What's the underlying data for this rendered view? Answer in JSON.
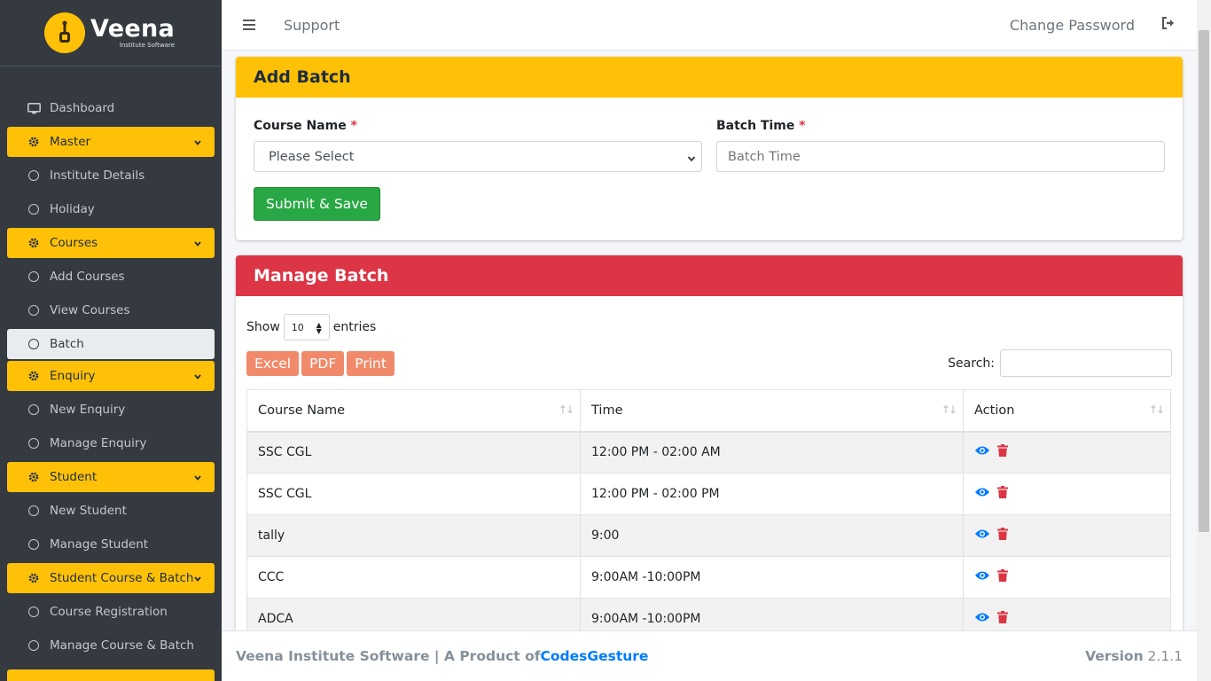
{
  "brand": {
    "name": "Veena",
    "subtitle": "Institute Software"
  },
  "sidebar": {
    "items": [
      {
        "label": "Dashboard",
        "type": "link",
        "icon": "monitor-icon"
      },
      {
        "label": "Master",
        "type": "header",
        "icon": "gear-icon"
      },
      {
        "label": "Institute Details",
        "type": "sub"
      },
      {
        "label": "Holiday",
        "type": "sub"
      },
      {
        "label": "Courses",
        "type": "header",
        "icon": "gear-icon"
      },
      {
        "label": "Add Courses",
        "type": "sub"
      },
      {
        "label": "View Courses",
        "type": "sub"
      },
      {
        "label": "Batch",
        "type": "active"
      },
      {
        "label": "Enquiry",
        "type": "header",
        "icon": "gear-icon"
      },
      {
        "label": "New Enquiry",
        "type": "sub"
      },
      {
        "label": "Manage Enquiry",
        "type": "sub"
      },
      {
        "label": "Student",
        "type": "header",
        "icon": "gear-icon"
      },
      {
        "label": "New Student",
        "type": "sub"
      },
      {
        "label": "Manage Student",
        "type": "sub"
      },
      {
        "label": "Student Course & Batch",
        "type": "header",
        "icon": "gear-icon"
      },
      {
        "label": "Course Registration",
        "type": "sub"
      },
      {
        "label": "Manage Course & Batch",
        "type": "sub"
      }
    ]
  },
  "topbar": {
    "support": "Support",
    "change_password": "Change Password"
  },
  "add_batch": {
    "title": "Add Batch",
    "course_label": "Course Name",
    "course_selected": "Please Select",
    "time_label": "Batch Time",
    "time_placeholder": "Batch Time",
    "required_mark": "*",
    "submit_label": "Submit & Save"
  },
  "manage_batch": {
    "title": "Manage Batch",
    "show_label": "Show",
    "entries_value": "10",
    "entries_label": "entries",
    "buttons": [
      "Excel",
      "PDF",
      "Print"
    ],
    "search_label": "Search:",
    "columns": [
      "Course Name",
      "Time",
      "Action"
    ],
    "rows": [
      {
        "course": "SSC CGL",
        "time": "12:00 PM - 02:00 AM"
      },
      {
        "course": "SSC CGL",
        "time": "12:00 PM - 02:00 PM"
      },
      {
        "course": "tally",
        "time": "9:00"
      },
      {
        "course": "CCC",
        "time": "9:00AM -10:00PM"
      },
      {
        "course": "ADCA",
        "time": "9:00AM -10:00PM"
      }
    ]
  },
  "footer": {
    "text": "Veena Institute Software | A Product of ",
    "company": "CodesGesture",
    "version_label": "Version",
    "version_number": "2.1.1"
  },
  "colors": {
    "accent": "#ffc107",
    "danger": "#dc3545",
    "success": "#28a745",
    "sidebar": "#343a40",
    "link": "#007bff",
    "dt_button": "#f08a6a"
  }
}
